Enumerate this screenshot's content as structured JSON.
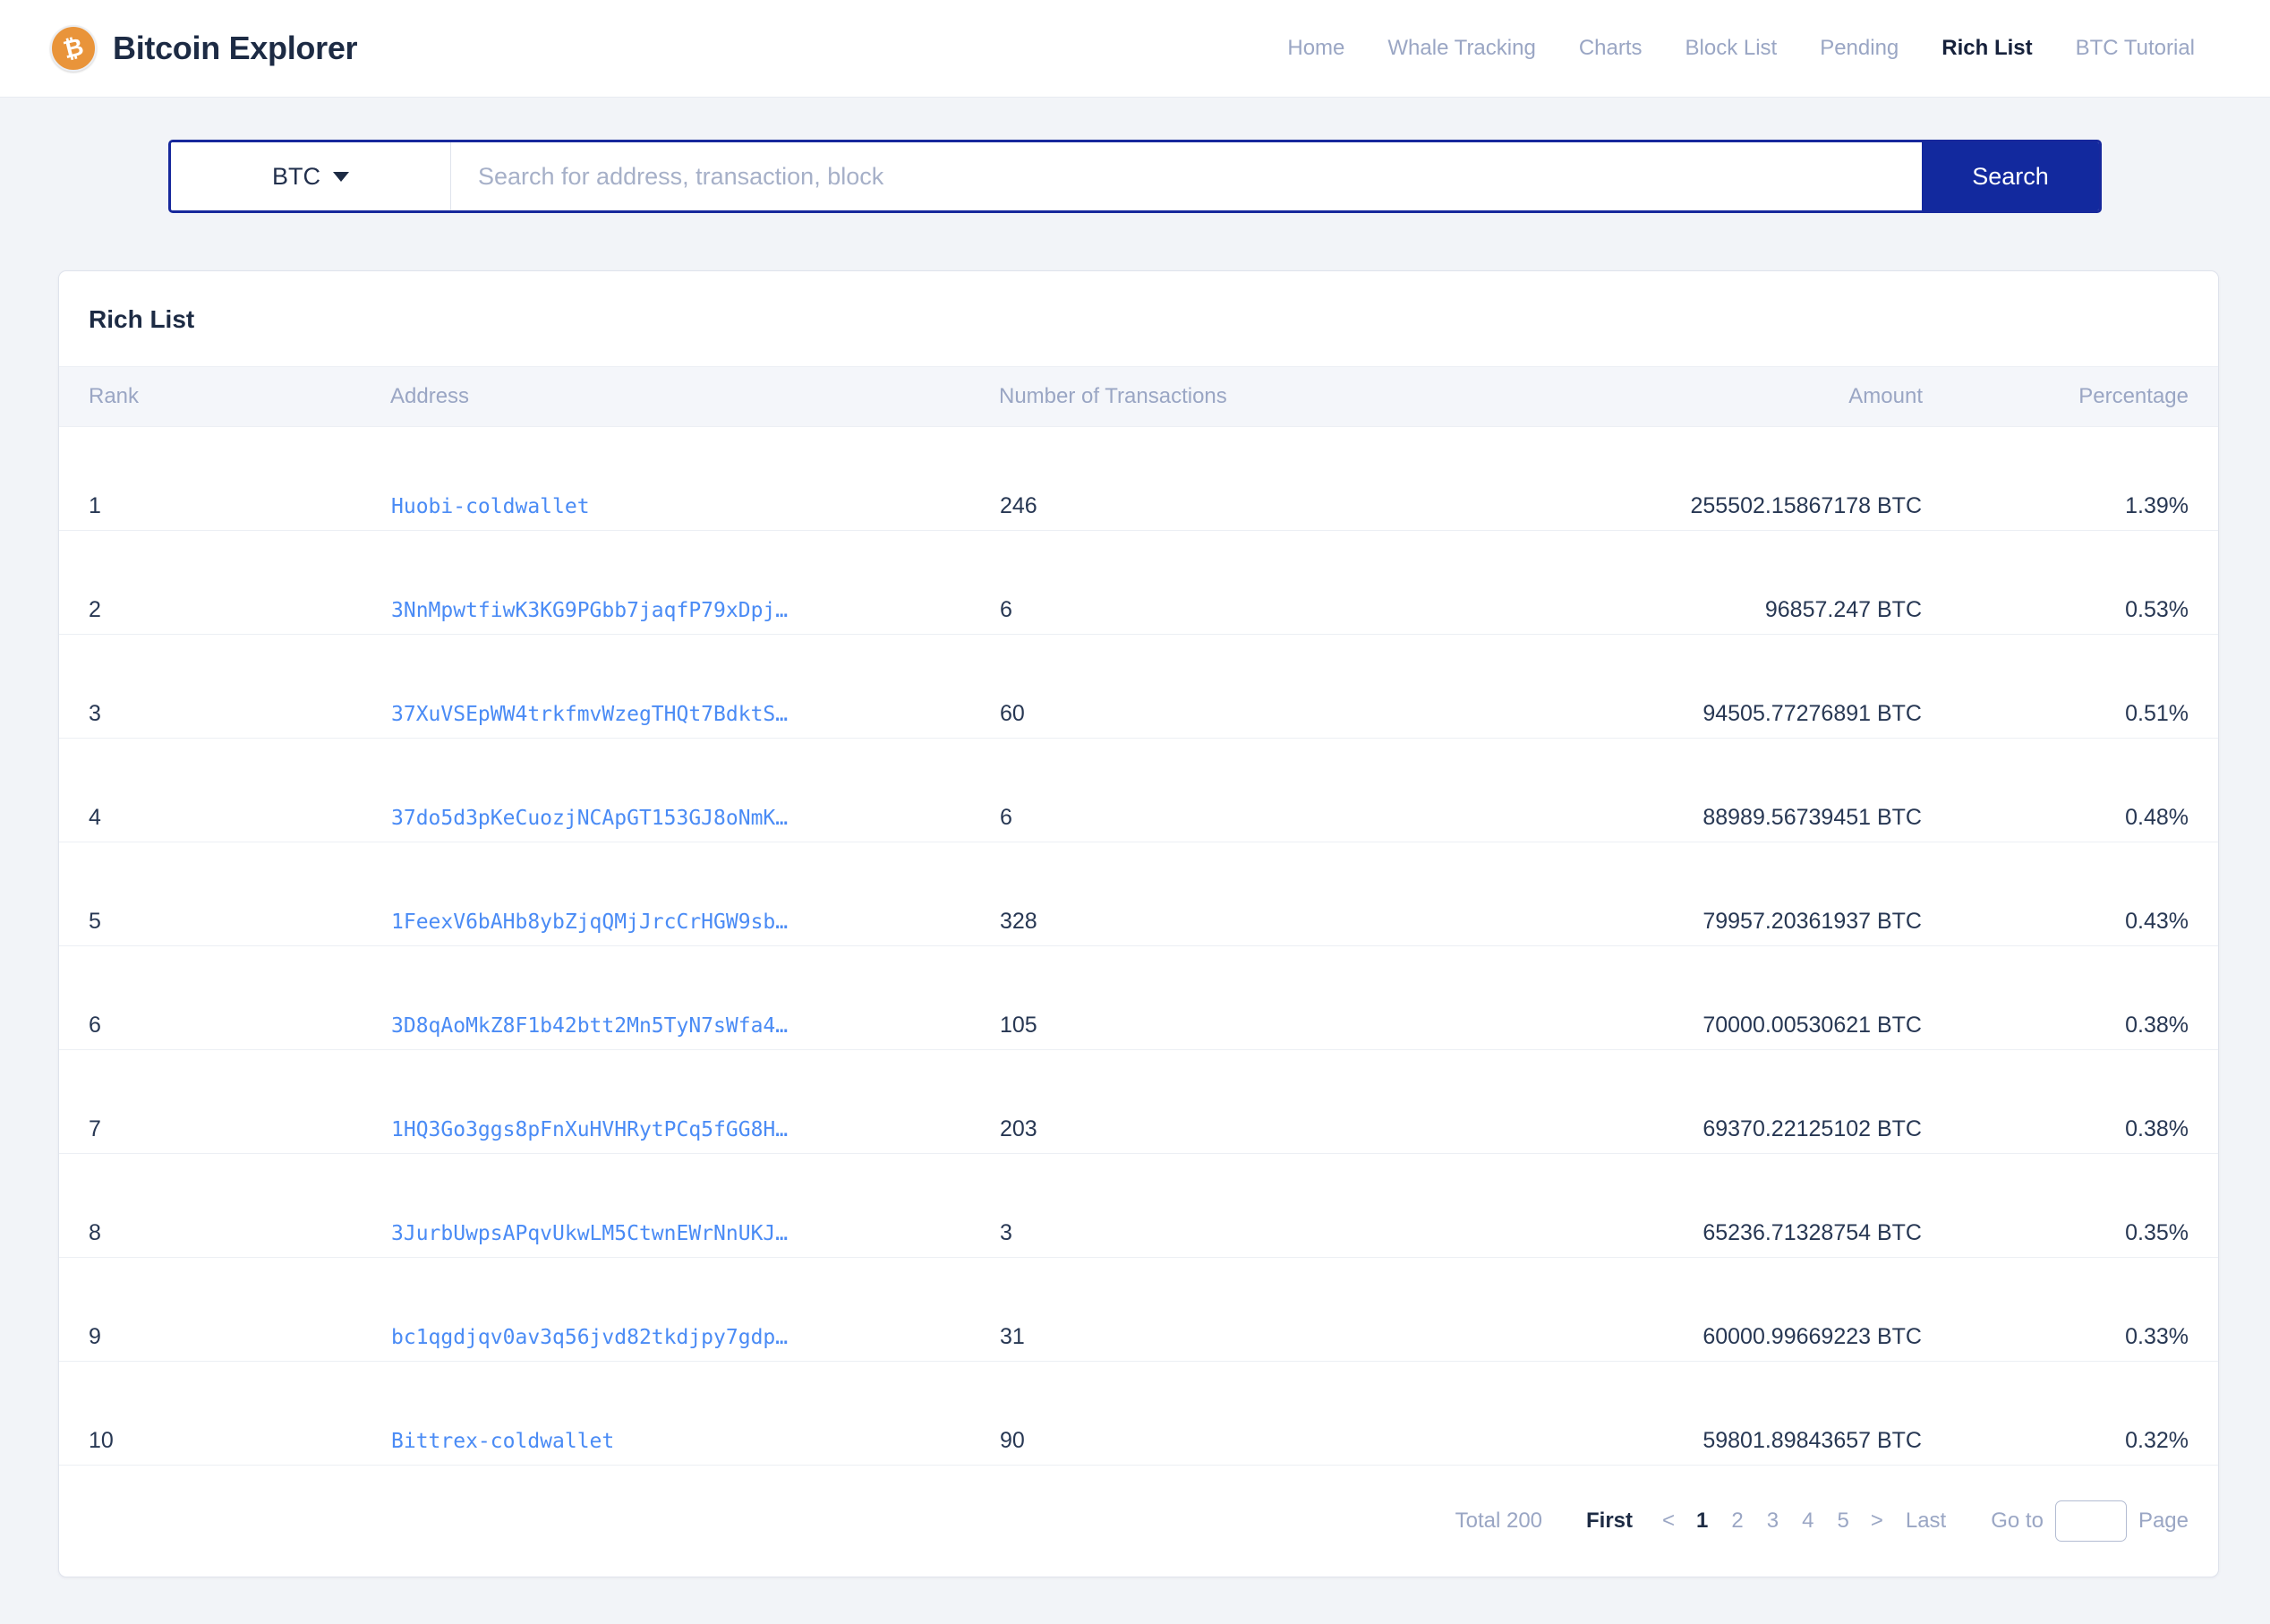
{
  "header": {
    "logo_icon": "bitcoin-icon",
    "brand_title": "Bitcoin Explorer",
    "nav": [
      {
        "label": "Home",
        "active": false
      },
      {
        "label": "Whale Tracking",
        "active": false
      },
      {
        "label": "Charts",
        "active": false
      },
      {
        "label": "Block List",
        "active": false
      },
      {
        "label": "Pending",
        "active": false
      },
      {
        "label": "Rich List",
        "active": true
      },
      {
        "label": "BTC Tutorial",
        "active": false
      }
    ]
  },
  "search": {
    "coin": "BTC",
    "coin_caret_icon": "chevron-down-icon",
    "value": "",
    "placeholder": "Search for address, transaction, block",
    "button_label": "Search",
    "border_color": "#17289c",
    "button_color": "#12299e"
  },
  "card": {
    "title": "Rich List",
    "columns": [
      "Rank",
      "Address",
      "Number of Transactions",
      "Amount",
      "Percentage"
    ],
    "rows": [
      {
        "rank": "1",
        "address": "Huobi-coldwallet",
        "transactions": "246",
        "amount": "255502.15867178 BTC",
        "percentage": "1.39%"
      },
      {
        "rank": "2",
        "address": "3NnMpwtfiwK3KG9PGbb7jaqfP79xDpj…",
        "transactions": "6",
        "amount": "96857.247 BTC",
        "percentage": "0.53%"
      },
      {
        "rank": "3",
        "address": "37XuVSEpWW4trkfmvWzegTHQt7BdktS…",
        "transactions": "60",
        "amount": "94505.77276891 BTC",
        "percentage": "0.51%"
      },
      {
        "rank": "4",
        "address": "37do5d3pKeCuozjNCApGT153GJ8oNmK…",
        "transactions": "6",
        "amount": "88989.56739451 BTC",
        "percentage": "0.48%"
      },
      {
        "rank": "5",
        "address": "1FeexV6bAHb8ybZjqQMjJrcCrHGW9sb…",
        "transactions": "328",
        "amount": "79957.20361937 BTC",
        "percentage": "0.43%"
      },
      {
        "rank": "6",
        "address": "3D8qAoMkZ8F1b42btt2Mn5TyN7sWfa4…",
        "transactions": "105",
        "amount": "70000.00530621 BTC",
        "percentage": "0.38%"
      },
      {
        "rank": "7",
        "address": "1HQ3Go3ggs8pFnXuHVHRytPCq5fGG8H…",
        "transactions": "203",
        "amount": "69370.22125102 BTC",
        "percentage": "0.38%"
      },
      {
        "rank": "8",
        "address": "3JurbUwpsAPqvUkwLM5CtwnEWrNnUKJ…",
        "transactions": "3",
        "amount": "65236.71328754 BTC",
        "percentage": "0.35%"
      },
      {
        "rank": "9",
        "address": "bc1qgdjqv0av3q56jvd82tkdjpy7gdp…",
        "transactions": "31",
        "amount": "60000.99669223 BTC",
        "percentage": "0.33%"
      },
      {
        "rank": "10",
        "address": "Bittrex-coldwallet",
        "transactions": "90",
        "amount": "59801.89843657 BTC",
        "percentage": "0.32%"
      }
    ]
  },
  "pagination": {
    "total_label": "Total 200",
    "first_label": "First",
    "prev_label": "<",
    "pages": [
      "1",
      "2",
      "3",
      "4",
      "5"
    ],
    "current_page": "1",
    "next_label": ">",
    "last_label": "Last",
    "goto_label": "Go to",
    "goto_value": "",
    "page_label": "Page"
  },
  "theme": {
    "page_bg": "#f2f4f8",
    "link_blue": "#4a8bf5",
    "text_dark": "#1d2b44",
    "muted": "#9aa6c4",
    "logo_orange": "#e9943a"
  }
}
